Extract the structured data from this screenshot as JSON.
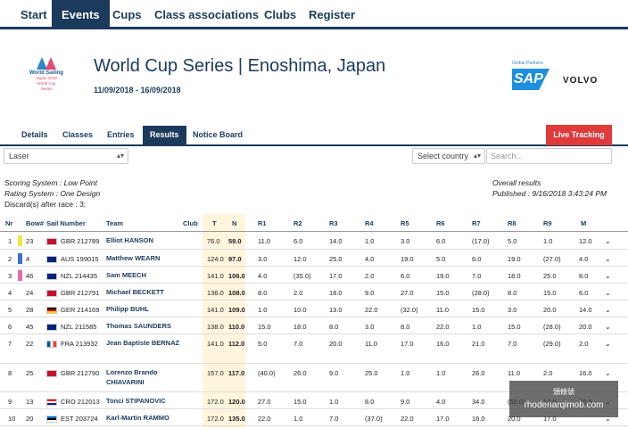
{
  "nav": [
    "Start",
    "Events",
    "Cups",
    "Class associations",
    "Clubs",
    "Register"
  ],
  "event": {
    "title": "World Cup Series | Enoshima, Japan",
    "dates": "11/09/2018 - 16/09/2018"
  },
  "logo": {
    "line1": "World Sailing",
    "line2": "Japan 2018",
    "line3": "World Cup",
    "line4": "Series"
  },
  "partners": {
    "label": "Global Partners",
    "sap": "SAP",
    "volvo": "VOLVO"
  },
  "subtabs": [
    "Details",
    "Classes",
    "Entries",
    "Results",
    "Notice Board"
  ],
  "live_tracking": "Live Tracking",
  "filters": {
    "class_select": "Laser",
    "country_select": "Select country",
    "search_placeholder": "Search..."
  },
  "meta": {
    "scoring": "Scoring System : Low Point",
    "rating": "Rating System : One Design",
    "discards": "Discard(s) after race : 3;",
    "overall": "Overall results",
    "published": "Published : 9/16/2018 3:43:24 PM"
  },
  "table": {
    "headers": [
      "Nr",
      "Bow#",
      "Sail Number",
      "Team",
      "Club",
      "T",
      "N",
      "R1",
      "R2",
      "R3",
      "R4",
      "R5",
      "R6",
      "R7",
      "R8",
      "R9",
      "M"
    ],
    "rows": [
      {
        "nr": "1",
        "bow": "23",
        "sail": "GBR 212789",
        "team": "Elliot HANSON",
        "t": "76.0",
        "n": "59.0",
        "r": [
          "11.0",
          "6.0",
          "14.0",
          "1.0",
          "3.0",
          "6.0",
          "(17.0)",
          "5.0",
          "1.0"
        ],
        "m": "12.0",
        "color": "#f5e642",
        "flag": "gbr"
      },
      {
        "nr": "2",
        "bow": "4",
        "sail": "AUS 199015",
        "team": "Matthew WEARN",
        "t": "124.0",
        "n": "97.0",
        "r": [
          "3.0",
          "12.0",
          "25.0",
          "4.0",
          "19.0",
          "5.0",
          "6.0",
          "19.0",
          "(27.0)"
        ],
        "m": "4.0",
        "color": "#3f6fd1",
        "flag": "aus"
      },
      {
        "nr": "3",
        "bow": "46",
        "sail": "NZL 214435",
        "team": "Sam MEECH",
        "t": "141.0",
        "n": "106.0",
        "r": [
          "4.0",
          "(35.0)",
          "17.0",
          "2.0",
          "6.0",
          "19.0",
          "7.0",
          "18.0",
          "25.0"
        ],
        "m": "8.0",
        "color": "#e36aa6",
        "flag": "nzl"
      },
      {
        "nr": "4",
        "bow": "24",
        "sail": "GBR 212791",
        "team": "Michael BECKETT",
        "t": "136.0",
        "n": "108.0",
        "r": [
          "8.0",
          "2.0",
          "18.0",
          "9.0",
          "27.0",
          "15.0",
          "(28.0)",
          "8.0",
          "15.0"
        ],
        "m": "6.0",
        "color": "",
        "flag": "gbr"
      },
      {
        "nr": "5",
        "bow": "28",
        "sail": "GER 214169",
        "team": "Philipp BUHL",
        "t": "141.0",
        "n": "109.0",
        "r": [
          "1.0",
          "10.0",
          "13.0",
          "22.0",
          "(32.0)",
          "11.0",
          "15.0",
          "3.0",
          "20.0"
        ],
        "m": "14.0",
        "color": "",
        "flag": "ger"
      },
      {
        "nr": "6",
        "bow": "45",
        "sail": "NZL 211585",
        "team": "Thomas SAUNDERS",
        "t": "138.0",
        "n": "110.0",
        "r": [
          "15.0",
          "18.0",
          "8.0",
          "3.0",
          "8.0",
          "22.0",
          "1.0",
          "15.0",
          "(28.0)"
        ],
        "m": "20.0",
        "color": "",
        "flag": "nzl"
      },
      {
        "nr": "7",
        "bow": "22",
        "sail": "FRA 213932",
        "team": "Jean Baptiste BERNAZ",
        "t": "141.0",
        "n": "112.0",
        "r": [
          "5.0",
          "7.0",
          "20.0",
          "11.0",
          "17.0",
          "16.0",
          "21.0",
          "7.0",
          "(29.0)"
        ],
        "m": "2.0",
        "color": "",
        "flag": "fra"
      },
      {
        "nr": "8",
        "bow": "25",
        "sail": "GBR 212790",
        "team": "Lorenzo Brando CHIAVARINI",
        "t": "157.0",
        "n": "117.0",
        "r": [
          "(40.0)",
          "26.0",
          "9.0",
          "25.0",
          "1.0",
          "1.0",
          "26.0",
          "11.0",
          "2.0"
        ],
        "m": "16.0",
        "color": "",
        "flag": "gbr"
      },
      {
        "nr": "9",
        "bow": "13",
        "sail": "CRO 212013",
        "team": "Tonci STIPANOVIC",
        "t": "172.0",
        "n": "120.0",
        "r": [
          "27.0",
          "15.0",
          "1.0",
          "8.0",
          "9.0",
          "4.0",
          "34.0",
          "(52.0)",
          "12.0"
        ],
        "m": "10.0",
        "color": "",
        "flag": "cro"
      },
      {
        "nr": "10",
        "bow": "20",
        "sail": "EST 203724",
        "team": "Karl-Martin RAMMO",
        "t": "172.0",
        "n": "135.0",
        "r": [
          "22.0",
          "1.0",
          "7.0",
          "(37.0)",
          "22.0",
          "17.0",
          "16.0",
          "20.0",
          "17.0"
        ],
        "m": "",
        "color": "",
        "flag": "est"
      }
    ]
  },
  "watermark": {
    "line1": "頭條號",
    "line2": "rhodenarqimob.com"
  }
}
